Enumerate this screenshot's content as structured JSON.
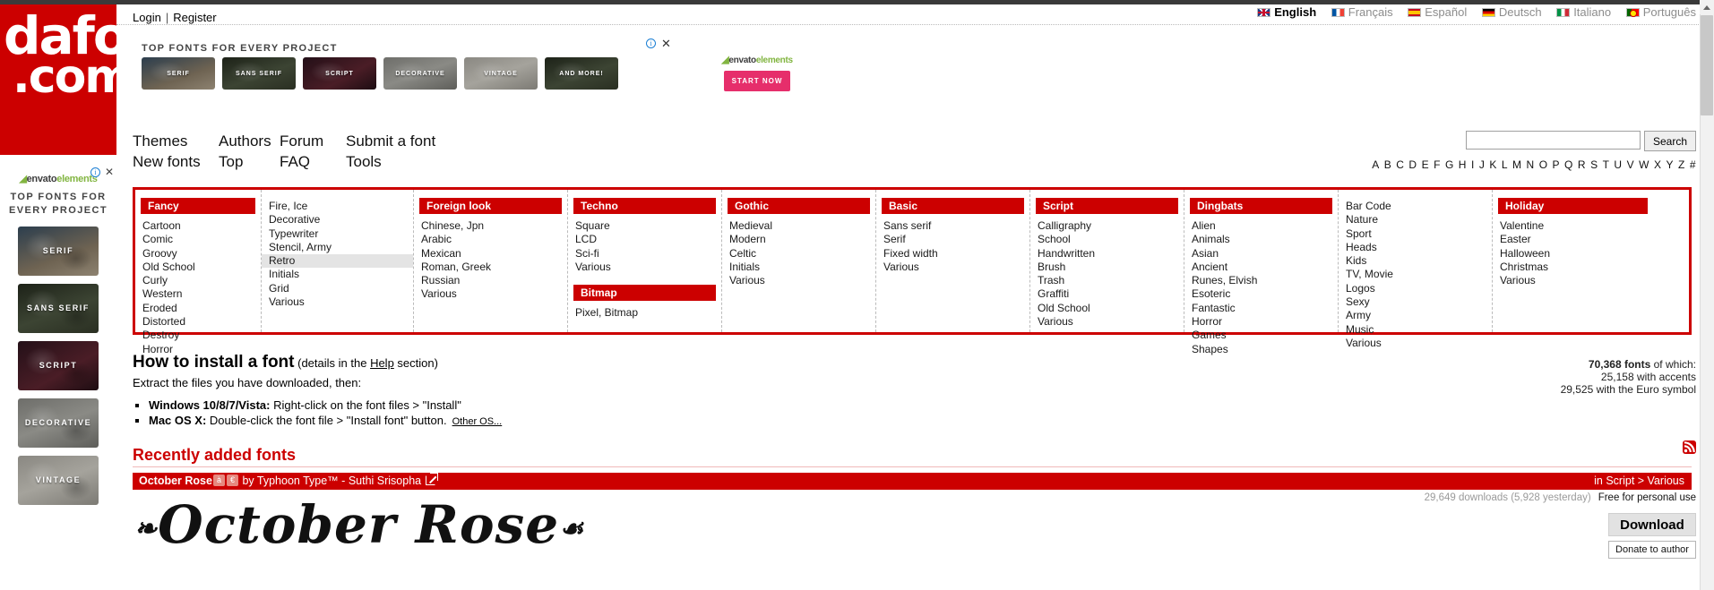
{
  "account": {
    "login": "Login",
    "separator": "|",
    "register": "Register"
  },
  "languages": [
    {
      "label": "English",
      "flag": "uk-flag-icon",
      "active": true
    },
    {
      "label": "Français",
      "flag": "france-flag-icon",
      "active": false
    },
    {
      "label": "Español",
      "flag": "spain-flag-icon",
      "active": false
    },
    {
      "label": "Deutsch",
      "flag": "germany-flag-icon",
      "active": false
    },
    {
      "label": "Italiano",
      "flag": "italy-flag-icon",
      "active": false
    },
    {
      "label": "Português",
      "flag": "portugal-flag-icon",
      "active": false
    }
  ],
  "logo": {
    "line1": "dafont",
    "line2": ".com",
    "color": "#cc0000"
  },
  "banner_ad": {
    "title": "TOP FONTS FOR EVERY PROJECT",
    "cards": [
      "SERIF",
      "SANS SERIF",
      "SCRIPT",
      "DECORATIVE",
      "VINTAGE",
      "AND MORE!"
    ],
    "brand_dark": "envato",
    "brand_light": "elements",
    "cta": "START NOW",
    "info_icon": "info-icon",
    "close_icon": "close-icon"
  },
  "sidebar_ad": {
    "brand_dark": "envato",
    "brand_light": "elements",
    "title": "TOP FONTS FOR EVERY PROJECT",
    "cards": [
      "SERIF",
      "SANS SERIF",
      "SCRIPT",
      "DECORATIVE",
      "VINTAGE"
    ],
    "info_icon": "info-icon",
    "close_icon": "close-icon"
  },
  "nav": {
    "row1": [
      "Themes",
      "Authors",
      "Forum",
      "Submit a font"
    ],
    "row2": [
      "New fonts",
      "Top",
      "FAQ",
      "Tools"
    ]
  },
  "search": {
    "value": "",
    "placeholder": "",
    "button": "Search"
  },
  "alphabet": [
    "A",
    "B",
    "C",
    "D",
    "E",
    "F",
    "G",
    "H",
    "I",
    "J",
    "K",
    "L",
    "M",
    "N",
    "O",
    "P",
    "Q",
    "R",
    "S",
    "T",
    "U",
    "V",
    "W",
    "X",
    "Y",
    "Z",
    "#"
  ],
  "categories": [
    {
      "header": "Fancy",
      "items": [
        "Cartoon",
        "Comic",
        "Groovy",
        "Old School",
        "Curly",
        "Western",
        "Eroded",
        "Distorted",
        "Destroy",
        "Horror"
      ]
    },
    {
      "header": null,
      "items": [
        "Fire, Ice",
        "Decorative",
        "Typewriter",
        "Stencil, Army",
        "Retro",
        "Initials",
        "Grid",
        "Various"
      ],
      "hovered": "Retro"
    },
    {
      "header": "Foreign look",
      "items": [
        "Chinese, Jpn",
        "Arabic",
        "Mexican",
        "Roman, Greek",
        "Russian",
        "Various"
      ]
    },
    {
      "header": "Techno",
      "items": [
        "Square",
        "LCD",
        "Sci-fi",
        "Various"
      ],
      "header2": "Bitmap",
      "items2": [
        "Pixel, Bitmap"
      ]
    },
    {
      "header": "Gothic",
      "items": [
        "Medieval",
        "Modern",
        "Celtic",
        "Initials",
        "Various"
      ]
    },
    {
      "header": "Basic",
      "items": [
        "Sans serif",
        "Serif",
        "Fixed width",
        "Various"
      ]
    },
    {
      "header": "Script",
      "items": [
        "Calligraphy",
        "School",
        "Handwritten",
        "Brush",
        "Trash",
        "Graffiti",
        "Old School",
        "Various"
      ]
    },
    {
      "header": "Dingbats",
      "items": [
        "Alien",
        "Animals",
        "Asian",
        "Ancient",
        "Runes, Elvish",
        "Esoteric",
        "Fantastic",
        "Horror",
        "Games",
        "Shapes"
      ]
    },
    {
      "header": null,
      "items": [
        "Bar Code",
        "Nature",
        "Sport",
        "Heads",
        "Kids",
        "TV, Movie",
        "Logos",
        "Sexy",
        "Army",
        "Music",
        "Various"
      ]
    },
    {
      "header": "Holiday",
      "items": [
        "Valentine",
        "Easter",
        "Halloween",
        "Christmas",
        "Various"
      ]
    }
  ],
  "howto": {
    "title": "How to install a font",
    "subtitle_pre": "(details in the ",
    "subtitle_link": "Help",
    "subtitle_post": " section)",
    "intro": "Extract the files you have downloaded, then:",
    "items": [
      {
        "bold": "Windows 10/8/7/Vista:",
        "text": " Right-click on the font files > \"Install\""
      },
      {
        "bold": "Mac OS X:",
        "text": " Double-click the font file > \"Install font\" button."
      }
    ],
    "other_os": "Other OS..."
  },
  "stats": {
    "line1_bold": "70,368 fonts",
    "line1_rest": " of which:",
    "line2": "25,158 with accents",
    "line3": "29,525 with the Euro symbol"
  },
  "recent": {
    "heading": "Recently added fonts",
    "rss_icon": "rss-icon",
    "font": {
      "name": "October Rose",
      "accent_badge": "à",
      "euro_badge": "€",
      "by": "by",
      "author": "Typhoon Type™ - Suthi Srisopha",
      "external_icon": "external-link-icon",
      "category": "in Script > Various",
      "downloads": "29,649 downloads (5,928 yesterday)",
      "license": "Free for personal use",
      "download_button": "Download",
      "donate_button": "Donate to author",
      "preview_text": "October Rose"
    }
  }
}
